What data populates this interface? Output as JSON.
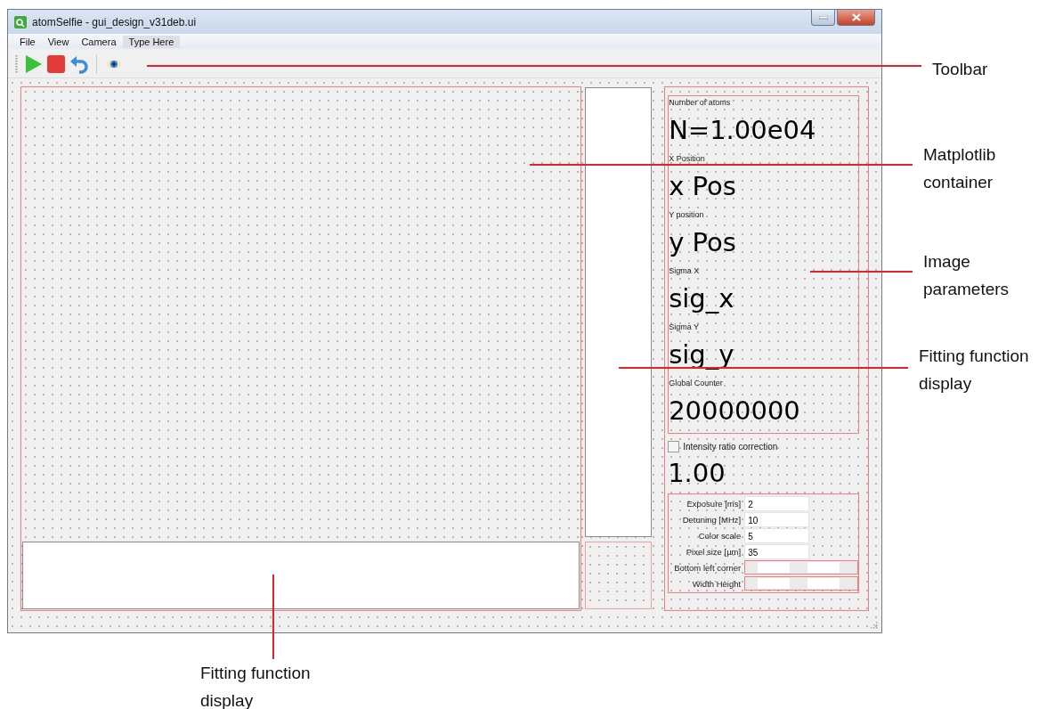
{
  "window": {
    "title": "atomSelfie - gui_design_v31deb.ui"
  },
  "menu": [
    {
      "label": "File",
      "placeholder": false
    },
    {
      "label": "View",
      "placeholder": false
    },
    {
      "label": "Camera",
      "placeholder": false
    },
    {
      "label": "Type Here",
      "placeholder": true
    }
  ],
  "toolbar": [
    {
      "kind": "play"
    },
    {
      "kind": "stop"
    },
    {
      "kind": "undo"
    },
    {
      "kind": "separator"
    },
    {
      "kind": "eye"
    }
  ],
  "parameters": [
    {
      "label": "Number of atoms",
      "value": "N=1.00e04"
    },
    {
      "label": "X Position",
      "value": "x Pos"
    },
    {
      "label": "Y position",
      "value": "y Pos"
    },
    {
      "label": "Sigma X",
      "value": "sig_x"
    },
    {
      "label": "Sigma Y",
      "value": "sig_y"
    },
    {
      "label": "Global Counter",
      "value": "20000000"
    }
  ],
  "intensity": {
    "label": "Intensity ratio  correction",
    "checked": false,
    "value": "1.00"
  },
  "settings": [
    {
      "kind": "text",
      "label": "Exposure [ms]",
      "value": "2"
    },
    {
      "kind": "text",
      "label": "Detuning [MHz]",
      "value": "10"
    },
    {
      "kind": "text",
      "label": "Color scale",
      "value": "5"
    },
    {
      "kind": "text",
      "label": "Pixel size [µm]",
      "value": "35"
    },
    {
      "kind": "range",
      "label": "Bottom left corner"
    },
    {
      "kind": "range",
      "label": "Width Height"
    }
  ],
  "annotations": [
    {
      "text": "Toolbar"
    },
    {
      "text": "Matplotlib container"
    },
    {
      "text": "Image parameters"
    },
    {
      "text": "Fitting function display"
    },
    {
      "text": "Fitting function display"
    }
  ]
}
